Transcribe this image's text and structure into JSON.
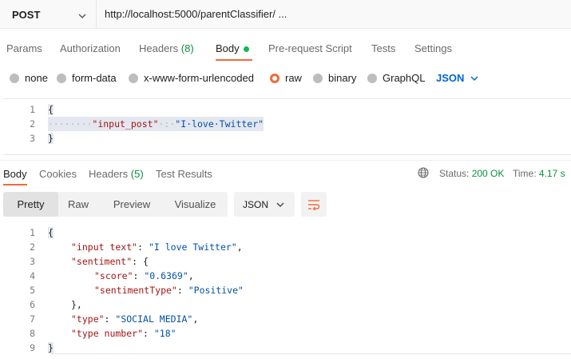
{
  "request": {
    "method": "POST",
    "url": "http://localhost:5000/parentClassifier/ ..."
  },
  "request_tabs": {
    "params": "Params",
    "authorization": "Authorization",
    "headers": "Headers",
    "headers_count": "(8)",
    "body": "Body",
    "pre_request": "Pre-request Script",
    "tests": "Tests",
    "settings": "Settings"
  },
  "body_types": {
    "none": "none",
    "form_data": "form-data",
    "urlencoded": "x-www-form-urlencoded",
    "raw": "raw",
    "binary": "binary",
    "graphql": "GraphQL",
    "language": "JSON",
    "selected": "raw"
  },
  "request_body": {
    "line_numbers": [
      "1",
      "2",
      "3"
    ],
    "open_brace": "{",
    "indent": "····",
    "key": "\"input_post\"",
    "sep": "·:·",
    "value": "\"I·love·Twitter\"",
    "close_brace": "}"
  },
  "response_tabs": {
    "body": "Body",
    "cookies": "Cookies",
    "headers": "Headers",
    "headers_count": "(5)",
    "test_results": "Test Results"
  },
  "response_status": {
    "status_label": "Status:",
    "status_value": "200 OK",
    "time_label": "Time:",
    "time_value": "4.17 s"
  },
  "response_toolbar": {
    "views": [
      "Pretty",
      "Raw",
      "Preview",
      "Visualize"
    ],
    "active_view": "Pretty",
    "format": "JSON"
  },
  "response_body": {
    "line_numbers": [
      "1",
      "2",
      "3",
      "4",
      "5",
      "6",
      "7",
      "8",
      "9"
    ],
    "l1": "{",
    "l2_key": "\"input text\"",
    "l2_val": "\"I love Twitter\"",
    "l3_key": "\"sentiment\"",
    "l3_rest": "{",
    "l4_key": "\"score\"",
    "l4_val": "\"0.6369\"",
    "l5_key": "\"sentimentType\"",
    "l5_val": "\"Positive\"",
    "l6": "},",
    "l7_key": "\"type\"",
    "l7_val": "\"SOCIAL MEDIA\"",
    "l8_key": "\"type number\"",
    "l8_val": "\"18\"",
    "l9": "}"
  },
  "icons": {
    "method_dropdown": "chevron-down-icon",
    "language_dropdown": "chevron-down-icon",
    "globe": "globe-icon",
    "wrap": "wrap-lines-icon"
  },
  "colors": {
    "accent": "#f26b3a",
    "success": "#0a8f3c",
    "link_blue": "#0265d2",
    "string": "#0451a5"
  }
}
